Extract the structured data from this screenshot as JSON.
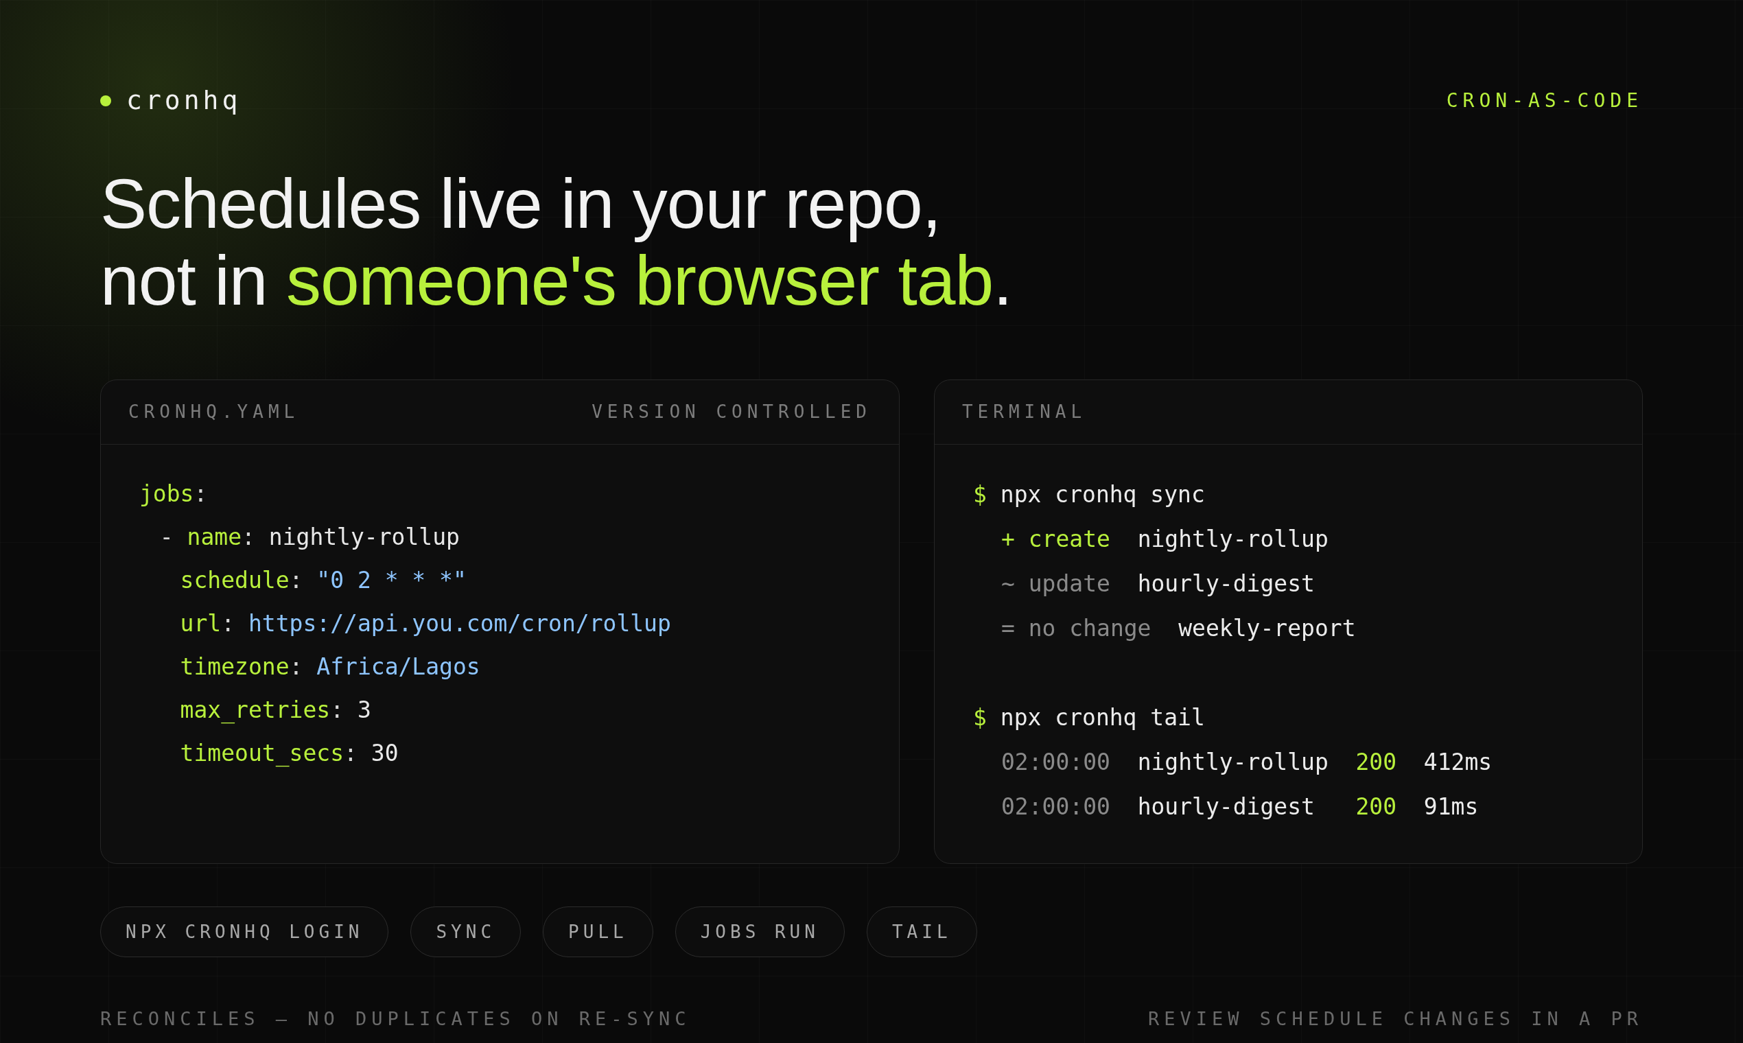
{
  "brand": {
    "name": "cronhq",
    "tag": "CRON-AS-CODE"
  },
  "headline": {
    "line_1": "Schedules live in your repo,",
    "line_2_start": "not in ",
    "line_2_accent": "someone's browser tab",
    "line_2_end": "."
  },
  "config_panel": {
    "title": "CRONHQ.YAML",
    "badge": "VERSION CONTROLLED",
    "lines": [
      {
        "kind": "top",
        "tokens": [
          {
            "text": "jobs",
            "kind": "key"
          },
          {
            "text": ":",
            "kind": "punct"
          }
        ]
      },
      {
        "kind": "item_start",
        "tokens": [
          {
            "text": "- ",
            "kind": "punct"
          },
          {
            "text": "name",
            "kind": "key"
          },
          {
            "text": ": ",
            "kind": "punct"
          },
          {
            "text": "nightly-rollup",
            "kind": "plain"
          }
        ]
      },
      {
        "kind": "item",
        "tokens": [
          {
            "text": "schedule",
            "kind": "key"
          },
          {
            "text": ": ",
            "kind": "punct"
          },
          {
            "text": "\"0 2 * * *\"",
            "kind": "string"
          }
        ]
      },
      {
        "kind": "item",
        "tokens": [
          {
            "text": "url",
            "kind": "key"
          },
          {
            "text": ": ",
            "kind": "punct"
          },
          {
            "text": "https://api.you.com/cron/rollup",
            "kind": "string"
          }
        ]
      },
      {
        "kind": "item",
        "tokens": [
          {
            "text": "timezone",
            "kind": "key"
          },
          {
            "text": ": ",
            "kind": "punct"
          },
          {
            "text": "Africa/Lagos",
            "kind": "string"
          }
        ]
      },
      {
        "kind": "item",
        "tokens": [
          {
            "text": "max_retries",
            "kind": "key"
          },
          {
            "text": ": ",
            "kind": "punct"
          },
          {
            "text": "3",
            "kind": "plain"
          }
        ]
      },
      {
        "kind": "item",
        "tokens": [
          {
            "text": "timeout_secs",
            "kind": "key"
          },
          {
            "text": ": ",
            "kind": "punct"
          },
          {
            "text": "30",
            "kind": "plain"
          }
        ]
      }
    ]
  },
  "terminal_panel": {
    "title": "TERMINAL",
    "sessions": [
      {
        "prompt": "$",
        "command": "npx cronhq sync",
        "output": [
          {
            "kind": "sync",
            "symbol": "+",
            "action": "create",
            "highlighted": true,
            "job": "nightly-rollup"
          },
          {
            "kind": "sync",
            "symbol": "~",
            "action": "update",
            "highlighted": false,
            "job": "hourly-digest"
          },
          {
            "kind": "sync",
            "symbol": "=",
            "action": "no change",
            "highlighted": false,
            "job": "weekly-report"
          }
        ]
      },
      {
        "prompt": "$",
        "command": "npx cronhq tail",
        "output": [
          {
            "kind": "log",
            "time": "02:00:00",
            "job": "nightly-rollup",
            "status": "200",
            "duration": "412ms"
          },
          {
            "kind": "log",
            "time": "02:00:00",
            "job": "hourly-digest",
            "status": "200",
            "duration": "91ms"
          }
        ]
      }
    ]
  },
  "command_pills": [
    "NPX CRONHQ LOGIN",
    "SYNC",
    "PULL",
    "JOBS RUN",
    "TAIL"
  ],
  "footer": {
    "left": "RECONCILES — NO DUPLICATES ON RE-SYNC",
    "right": "REVIEW SCHEDULE CHANGES IN A PR"
  }
}
